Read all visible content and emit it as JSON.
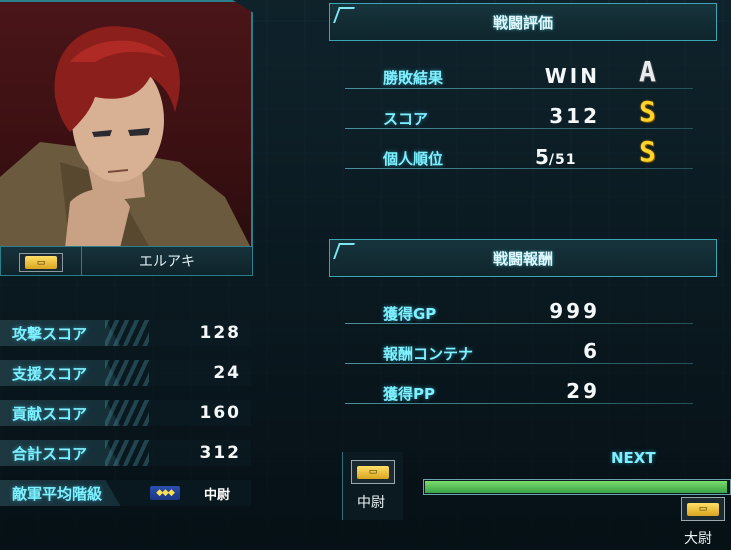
{
  "player": {
    "name": "エルアキ",
    "rank_icon": "gold-rank-insignia-icon"
  },
  "scores": [
    {
      "label": "攻撃スコア",
      "value": "128"
    },
    {
      "label": "支援スコア",
      "value": "24"
    },
    {
      "label": "貢献スコア",
      "value": "160"
    },
    {
      "label": "合計スコア",
      "value": "312"
    }
  ],
  "enemy_avg_rank": {
    "label": "敵軍平均階級",
    "icon": "blue-rank-insignia-icon",
    "value": "中尉"
  },
  "evaluation": {
    "title": "戦闘評価",
    "rows": [
      {
        "label": "勝敗結果",
        "value": "WIN",
        "grade": "A"
      },
      {
        "label": "スコア",
        "value": "312",
        "grade": "S"
      },
      {
        "label": "個人順位",
        "value": "5",
        "value_suffix": "/51",
        "grade": "S"
      }
    ]
  },
  "rewards": {
    "title": "戦闘報酬",
    "rows": [
      {
        "label": "獲得GP",
        "value": "999"
      },
      {
        "label": "報酬コンテナ",
        "value": "6"
      },
      {
        "label": "獲得PP",
        "value": "29"
      }
    ]
  },
  "progress": {
    "current_rank": "中尉",
    "next_label": "NEXT",
    "next_rank": "大尉",
    "fill_fraction": 0.995
  },
  "colors": {
    "accent": "#7ff0ff",
    "grade_s": "#ffd52a",
    "grade_a": "#e8ecee",
    "progress": "#3aa34a"
  }
}
